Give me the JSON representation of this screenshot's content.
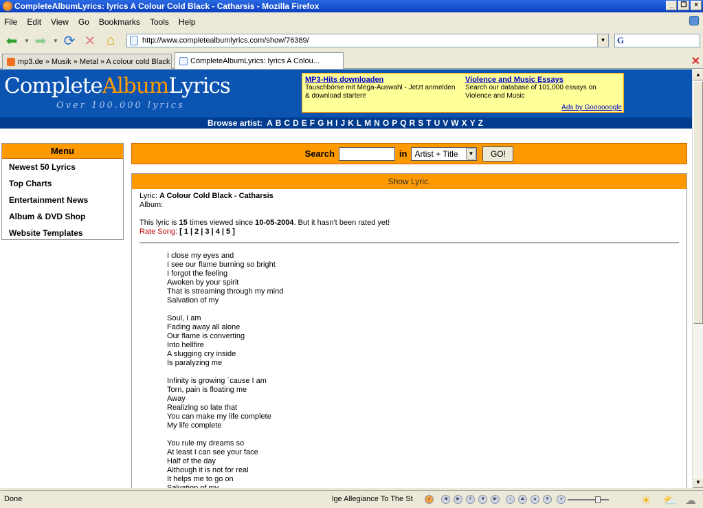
{
  "window": {
    "title": "CompleteAlbumLyrics: lyrics A Colour Cold Black - Catharsis - Mozilla Firefox"
  },
  "menubar": [
    "File",
    "Edit",
    "View",
    "Go",
    "Bookmarks",
    "Tools",
    "Help"
  ],
  "address": {
    "url": "http://www.completealbumlyrics.com/show/76389/"
  },
  "search_engine": {
    "glyph": "G"
  },
  "tabs": [
    {
      "label": "mp3.de » Musik » Metal » A colour cold Black"
    },
    {
      "label": "CompleteAlbumLyrics: lyrics A Colou..."
    }
  ],
  "site": {
    "logo_part1": "Complete",
    "logo_part2": "Album",
    "logo_part3": "Lyrics",
    "tagline": "Over 100.000 lyrics"
  },
  "ads": [
    {
      "title": "MP3-Hits downloaden",
      "text": "Tauschbörse mit Mega-Auswahl - Jetzt anmelden & download starten!"
    },
    {
      "title": "Violence and Music Essays",
      "text": "Search our database of 101,000 essays on Violence and Music"
    }
  ],
  "ads_by": "Ads by Goooooogle",
  "browse": {
    "label": "Browse artist:",
    "letters": [
      "A",
      "B",
      "C",
      "D",
      "E",
      "F",
      "G",
      "H",
      "I",
      "J",
      "K",
      "L",
      "M",
      "N",
      "O",
      "P",
      "Q",
      "R",
      "S",
      "T",
      "U",
      "V",
      "W",
      "X",
      "Y",
      "Z"
    ]
  },
  "menu": {
    "title": "Menu",
    "items": [
      "Newest 50 Lyrics",
      "Top Charts",
      "Entertainment News",
      "Album & DVD Shop",
      "Website Templates"
    ]
  },
  "search": {
    "label": "Search",
    "in_label": "in",
    "scope": "Artist + Title",
    "go": "GO!"
  },
  "lyric": {
    "panel_title": "Show Lyric.",
    "lyric_label": "Lyric:",
    "song": "A Colour Cold Black - Catharsis",
    "album_label": "Album:",
    "views_prefix": "This lyric is",
    "views": "15",
    "views_mid": "times viewed since",
    "since": "10-05-2004",
    "views_suffix": ". But it hasn't been rated yet!",
    "rate_label": "Rate Song:",
    "rate_options": "[ 1 | 2 | 3 | 4 | 5 ]",
    "stanzas": [
      [
        "I close my eyes and",
        "I see our flame burning so bright",
        "I forgot the feeling",
        "Awoken by your spirit",
        "That is streaming through my mind",
        "Salvation of my"
      ],
      [
        "Soul, I am",
        "Fading away all alone",
        "Our flame is converting",
        "Into hellfire",
        "A slugging cry inside",
        "Is paralyzing me"
      ],
      [
        "Infinity is growing ´cause I am",
        "Torn, pain is floating me",
        "Away",
        "Realizing so late that",
        "You can make my life complete",
        "My life complete"
      ],
      [
        "You rule my dreams so",
        "At least I can see your face",
        "Half of the day",
        "Although it is not for real",
        "It helps me to go on",
        "Salvation of my"
      ]
    ]
  },
  "status": {
    "text": "Done",
    "track": "lge Allegiance To The St"
  },
  "colors": {
    "header_blue": "#0b54b2",
    "accent_orange": "#ff9900",
    "ad_yellow": "#ffff99"
  }
}
